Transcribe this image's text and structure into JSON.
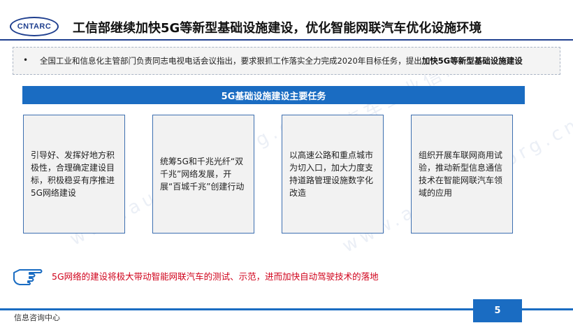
{
  "header": {
    "logo_text": "CNTARC",
    "title": "工信部继续加快5G等新型基础设施建设，优化智能网联汽车优化设施环境"
  },
  "bullet": {
    "marker": "•",
    "text_plain": "全国工业和信息化主管部门负责同志电视电话会议指出，要求狠抓工作落实全力完成2020年目标任务，提出",
    "text_bold": "加快5G等新型基础设施建设"
  },
  "banner": {
    "label": "5G基础设施建设主要任务"
  },
  "cards": [
    {
      "text": "引导好、发挥好地方积极性，合理确定建设目标，积极稳妥有序推进5G网络建设"
    },
    {
      "text": "统筹5G和千兆光纤“双千兆”网络发展，开展“百城千兆”创建行动"
    },
    {
      "text": "以高速公路和重点城市为切入口，加大力度支持道路管理设施数字化改造"
    },
    {
      "text": "组织开展车联网商用试验，推动新型信息通信技术在智能网联汽车领域的应用"
    }
  ],
  "note": {
    "text": "5G网络的建设将极大带动智能网联汽车的测试、示范，进而加快自动驾驶技术的落地",
    "icon": "pointing-hand-icon"
  },
  "footer": {
    "left_text": "信息咨询中心",
    "page_number": "5"
  },
  "watermark": {
    "text_cn": "中国汽车工业信息网",
    "text_en": "www.autoinfo.org.cn"
  },
  "colors": {
    "brand_blue": "#1a6cc2",
    "logo_blue": "#1f3f8f",
    "note_red": "#d0021b",
    "card_border": "#3d6fb0"
  }
}
